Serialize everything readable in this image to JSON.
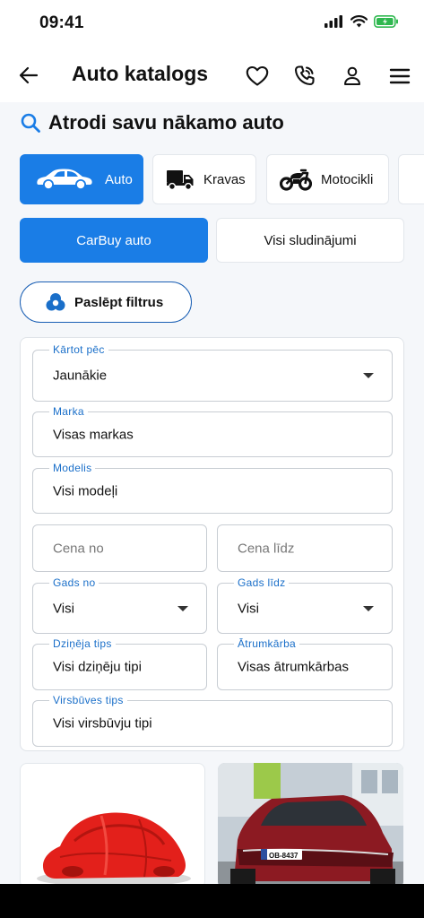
{
  "status_bar": {
    "time": "09:41"
  },
  "header": {
    "title": "Auto katalogs"
  },
  "search_heading": "Atrodi savu nākamo auto",
  "categories": [
    {
      "label": "Auto",
      "icon": "car-icon",
      "active": true
    },
    {
      "label": "Kravas",
      "icon": "truck-icon",
      "active": false
    },
    {
      "label": "Motocikli",
      "icon": "motorcycle-icon",
      "active": false
    }
  ],
  "segments": [
    {
      "label": "CarBuy auto",
      "active": true
    },
    {
      "label": "Visi sludinājumi",
      "active": false
    }
  ],
  "hide_filters_label": "Paslēpt filtrus",
  "filters": {
    "sort": {
      "label": "Kārtot pēc",
      "value": "Jaunākie"
    },
    "make": {
      "label": "Marka",
      "value": "Visas markas"
    },
    "model": {
      "label": "Modelis",
      "value": "Visi modeļi"
    },
    "price_from": {
      "placeholder": "Cena no"
    },
    "price_to": {
      "placeholder": "Cena līdz"
    },
    "year_from": {
      "label": "Gads no",
      "value": "Visi"
    },
    "year_to": {
      "label": "Gads līdz",
      "value": "Visi"
    },
    "drive_type": {
      "label": "Dziņēja tips",
      "value": "Visi dziņēju tipi"
    },
    "gearbox": {
      "label": "Ātrumkārba",
      "value": "Visas ātrumkārbas"
    },
    "body_type": {
      "label": "Virsbūves tips",
      "value": "Visi virsbūvju tipi"
    }
  },
  "listing_cards": [
    {
      "image": "covered-red-car"
    },
    {
      "image": "red-suv-photo",
      "plate": "OB-8437"
    }
  ],
  "colors": {
    "accent": "#1a7de6",
    "label_blue": "#1a6fc9"
  }
}
